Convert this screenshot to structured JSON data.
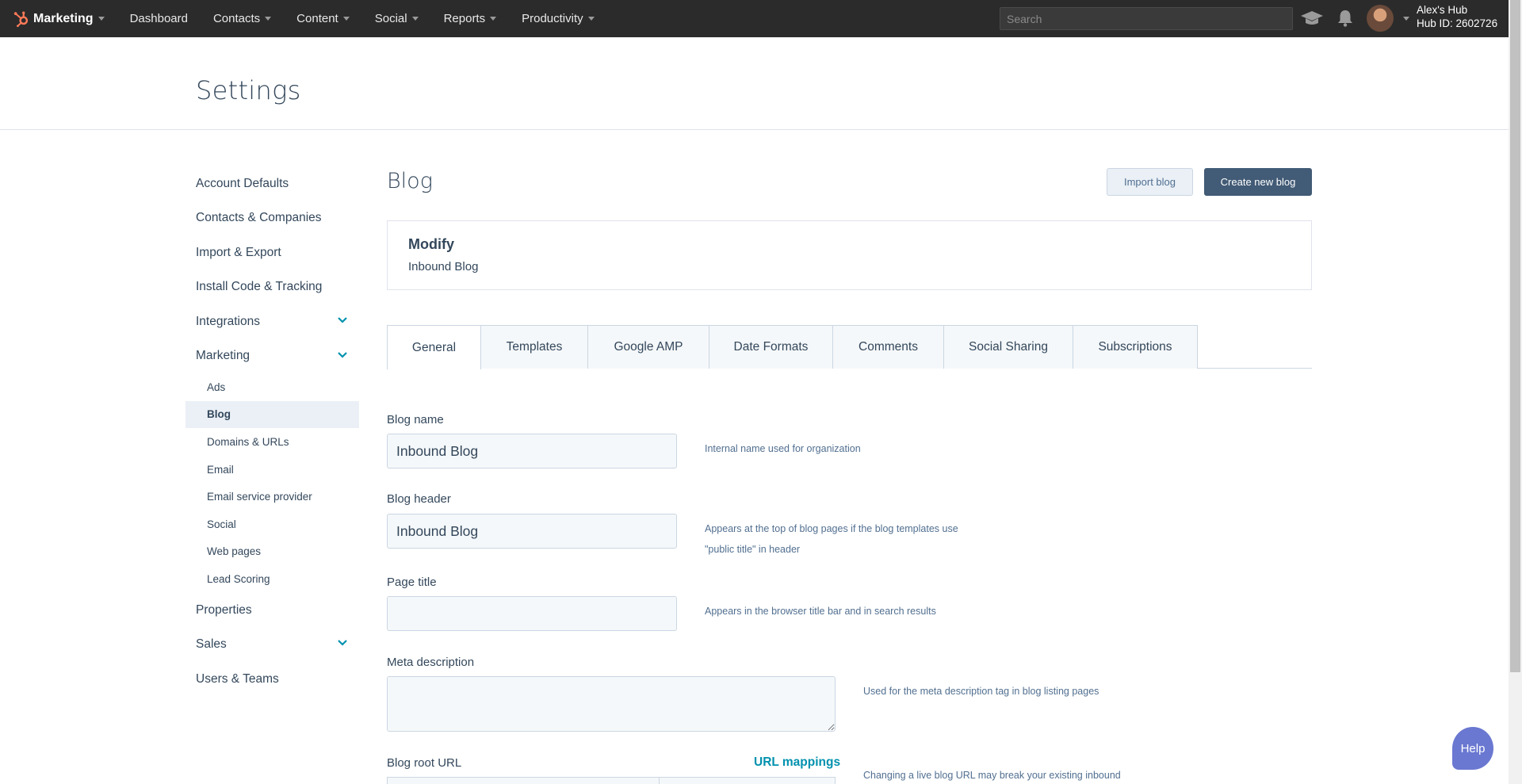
{
  "topnav": {
    "brand": "Marketing",
    "items": [
      {
        "label": "Dashboard",
        "caret": false
      },
      {
        "label": "Contacts",
        "caret": true
      },
      {
        "label": "Content",
        "caret": true
      },
      {
        "label": "Social",
        "caret": true
      },
      {
        "label": "Reports",
        "caret": true
      },
      {
        "label": "Productivity",
        "caret": true
      }
    ],
    "search_placeholder": "Search",
    "hub_name": "Alex's Hub",
    "hub_id": "Hub ID: 2602726",
    "icons": [
      "academy-icon",
      "notifications-icon"
    ]
  },
  "page": {
    "title": "Settings"
  },
  "sidebar": {
    "items": [
      {
        "label": "Account Defaults"
      },
      {
        "label": "Contacts & Companies"
      },
      {
        "label": "Import & Export"
      },
      {
        "label": "Install Code & Tracking"
      },
      {
        "label": "Integrations",
        "expandable": true
      },
      {
        "label": "Marketing",
        "expandable": true
      }
    ],
    "marketing_sub": [
      "Ads",
      "Blog",
      "Domains & URLs",
      "Email",
      "Email service provider",
      "Social",
      "Web pages",
      "Lead Scoring"
    ],
    "active_sub": "Blog",
    "bottom_items": [
      {
        "label": "Properties"
      },
      {
        "label": "Sales",
        "expandable": true
      },
      {
        "label": "Users & Teams"
      }
    ]
  },
  "main": {
    "title": "Blog",
    "import_label": "Import blog",
    "create_label": "Create new blog",
    "modify": {
      "title": "Modify",
      "subtitle": "Inbound Blog"
    },
    "tabs": [
      "General",
      "Templates",
      "Google AMP",
      "Date Formats",
      "Comments",
      "Social Sharing",
      "Subscriptions"
    ],
    "active_tab": "General",
    "fields": {
      "blog_name": {
        "label": "Blog name",
        "value": "Inbound Blog",
        "help": "Internal name used for organization"
      },
      "blog_header": {
        "label": "Blog header",
        "value": "Inbound Blog",
        "help_line1": "Appears at the top of blog pages if the blog templates use",
        "help_line2": "\"public title\" in header"
      },
      "page_title": {
        "label": "Page title",
        "value": "",
        "help": "Appears in the browser title bar and in search results"
      },
      "meta_description": {
        "label": "Meta description",
        "value": "",
        "help": "Used for the meta description tag in blog listing pages"
      },
      "blog_root_url": {
        "label": "Blog root URL",
        "link": "URL mappings",
        "help": "Changing a live blog URL may break your existing inbound"
      }
    }
  },
  "help_label": "Help",
  "colors": {
    "nav_bg": "#2b2b2b",
    "primary_button": "#425b76",
    "link": "#0091ae",
    "help_button": "#6a78d1",
    "brand_orange": "#ff7a59"
  }
}
